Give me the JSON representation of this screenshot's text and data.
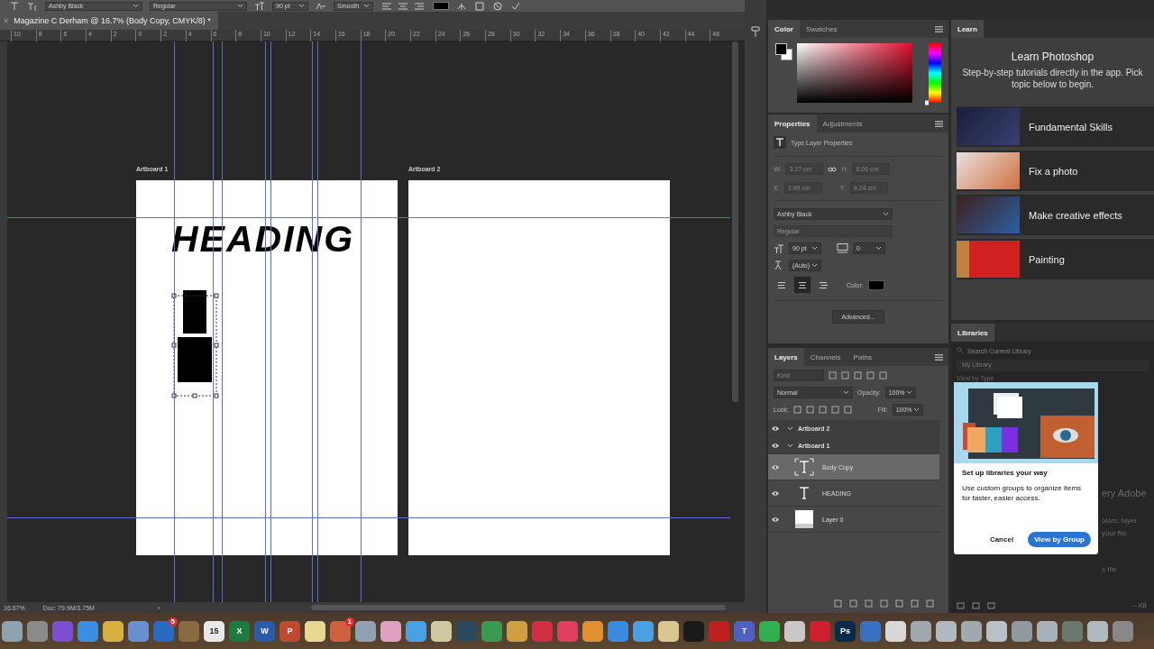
{
  "options_bar": {
    "font": "Ashby Black",
    "style": "Regular",
    "size": "90 pt",
    "antialias": "Smooth"
  },
  "document_tab": {
    "close": "×",
    "title": "Magazine C Derham @ 16.7% (Body Copy, CMYK/8) *"
  },
  "ruler": {
    "labels": [
      "10",
      "8",
      "6",
      "4",
      "2",
      "0",
      "2",
      "4",
      "6",
      "8",
      "10",
      "12",
      "14",
      "16",
      "18",
      "20",
      "22",
      "24",
      "26",
      "28",
      "30",
      "32",
      "34",
      "36",
      "38",
      "40",
      "42",
      "44",
      "46"
    ]
  },
  "canvas": {
    "artboards": [
      {
        "label": "Artboard 1",
        "heading": "HEADING"
      },
      {
        "label": "Artboard 2"
      }
    ]
  },
  "status_bar": {
    "zoom": "16.67%",
    "doc": "Doc: 79.9M/3.75M",
    "arrow": "›"
  },
  "color_panel": {
    "tabs": [
      {
        "label": "Color",
        "selected": true
      },
      {
        "label": "Swatches",
        "selected": false
      }
    ],
    "hue": {
      "level": 0
    }
  },
  "properties": {
    "tabs": [
      {
        "label": "Properties",
        "selected": true
      },
      {
        "label": "Adjustments",
        "selected": false
      }
    ],
    "header": "Type Layer Properties",
    "transform": {
      "disabled": true,
      "fields": [
        {
          "label": "W:",
          "value": "3.37 cm"
        },
        {
          "label": "H:",
          "value": "8.06 cm"
        },
        {
          "label": "X:",
          "value": "2.99 cm"
        },
        {
          "label": "Y:",
          "value": "9.24 cm"
        }
      ]
    },
    "font": "Ashby Black",
    "style": {
      "value": "Regular",
      "disabled": true
    },
    "size": "90 pt",
    "tracking": "0",
    "leading": "(Auto)",
    "align": [
      {
        "selected": false
      },
      {
        "selected": true
      },
      {
        "selected": false
      }
    ],
    "color_label": "Color:",
    "advanced": "Advanced..."
  },
  "layers_panel": {
    "tabs": [
      {
        "label": "Layers",
        "selected": true
      },
      {
        "label": "Channels",
        "selected": false
      },
      {
        "label": "Paths",
        "selected": false
      }
    ],
    "filter_placeholder": "Kind",
    "blend_mode": "Normal",
    "opacity_label": "Opacity:",
    "opacity": "100%",
    "lock_label": "Lock:",
    "fill_label": "Fill:",
    "fill": "100%",
    "layers": [
      {
        "name": "Artboard 2",
        "kind": "artboard",
        "visible": true,
        "expanded": true,
        "selected": false
      },
      {
        "name": "Artboard 1",
        "kind": "artboard",
        "visible": true,
        "expanded": true,
        "selected": false,
        "children": [
          {
            "name": "Body Copy",
            "kind": "text",
            "visible": true,
            "selected": true
          },
          {
            "name": "HEADING",
            "kind": "text",
            "visible": true,
            "selected": false
          },
          {
            "name": "Layer 0",
            "kind": "pixel",
            "visible": true,
            "selected": false
          }
        ]
      }
    ]
  },
  "learn": {
    "tab": "Learn",
    "title": "Learn Photoshop",
    "intro_lines": [
      "Step-by-step tutorials directly in the app. Pick",
      "topic below to begin."
    ],
    "items": [
      "Fundamental Skills",
      "Fix a photo",
      "Make creative effects",
      "Painting"
    ]
  },
  "libraries": {
    "tab": "Libraries",
    "search_placeholder": "Search Current Library",
    "library": "My Library",
    "view": "View by Type",
    "background_texts": [
      "ery Adobe",
      "olors, layer",
      "your file.",
      "s file"
    ],
    "size": "– KB",
    "popover": {
      "title": "Set up libraries your way",
      "body": "Use custom groups to organize items for faster, easier access.",
      "cancel": "Cancel",
      "confirm": "View by Group"
    }
  },
  "dock": [
    {
      "color": "#8fa0b0"
    },
    {
      "color": "#8a8a8a"
    },
    {
      "color": "#7a4fd0"
    },
    {
      "color": "#3a8fe0"
    },
    {
      "color": "#d8b040"
    },
    {
      "color": "#6a8fd0"
    },
    {
      "color": "#2a6ac0",
      "badge": "5"
    },
    {
      "color": "#8a6a40"
    },
    {
      "color": "#e8e8e8",
      "label": "15"
    },
    {
      "color": "#1e7a40",
      "label": "X"
    },
    {
      "color": "#2a5aa8",
      "label": "W"
    },
    {
      "color": "#c04a30",
      "label": "P"
    },
    {
      "color": "#e8d890"
    },
    {
      "color": "#d06040",
      "badge": "1"
    },
    {
      "color": "#90a0b0"
    },
    {
      "color": "#e0a0c0"
    },
    {
      "color": "#4aa0e0"
    },
    {
      "color": "#d0c8a0"
    },
    {
      "color": "#2a4a60"
    },
    {
      "color": "#3a9a50"
    },
    {
      "color": "#d0a040"
    },
    {
      "color": "#d03040"
    },
    {
      "color": "#e04060"
    },
    {
      "color": "#e09030"
    },
    {
      "color": "#3a8ae0"
    },
    {
      "color": "#4aa0e0"
    },
    {
      "color": "#d8c890"
    },
    {
      "color": "#1a1a1a"
    },
    {
      "color": "#c02020"
    },
    {
      "color": "#5060c0",
      "label": "T"
    },
    {
      "color": "#30b050"
    },
    {
      "color": "#c8c8c8"
    },
    {
      "color": "#d02030"
    },
    {
      "color": "#0a2a4a",
      "label": "Ps"
    },
    {
      "color": "#3a70c0"
    },
    {
      "color": "#d8d8d8"
    },
    {
      "color": "#a0a8b0"
    },
    {
      "color": "#b0b8c0"
    },
    {
      "color": "#a0a8b0"
    },
    {
      "color": "#b8c0c8"
    },
    {
      "color": "#909aa0"
    },
    {
      "color": "#a8b0b8"
    },
    {
      "color": "#6a7a70"
    },
    {
      "color": "#b0b8c0"
    },
    {
      "color": "#888888"
    }
  ]
}
